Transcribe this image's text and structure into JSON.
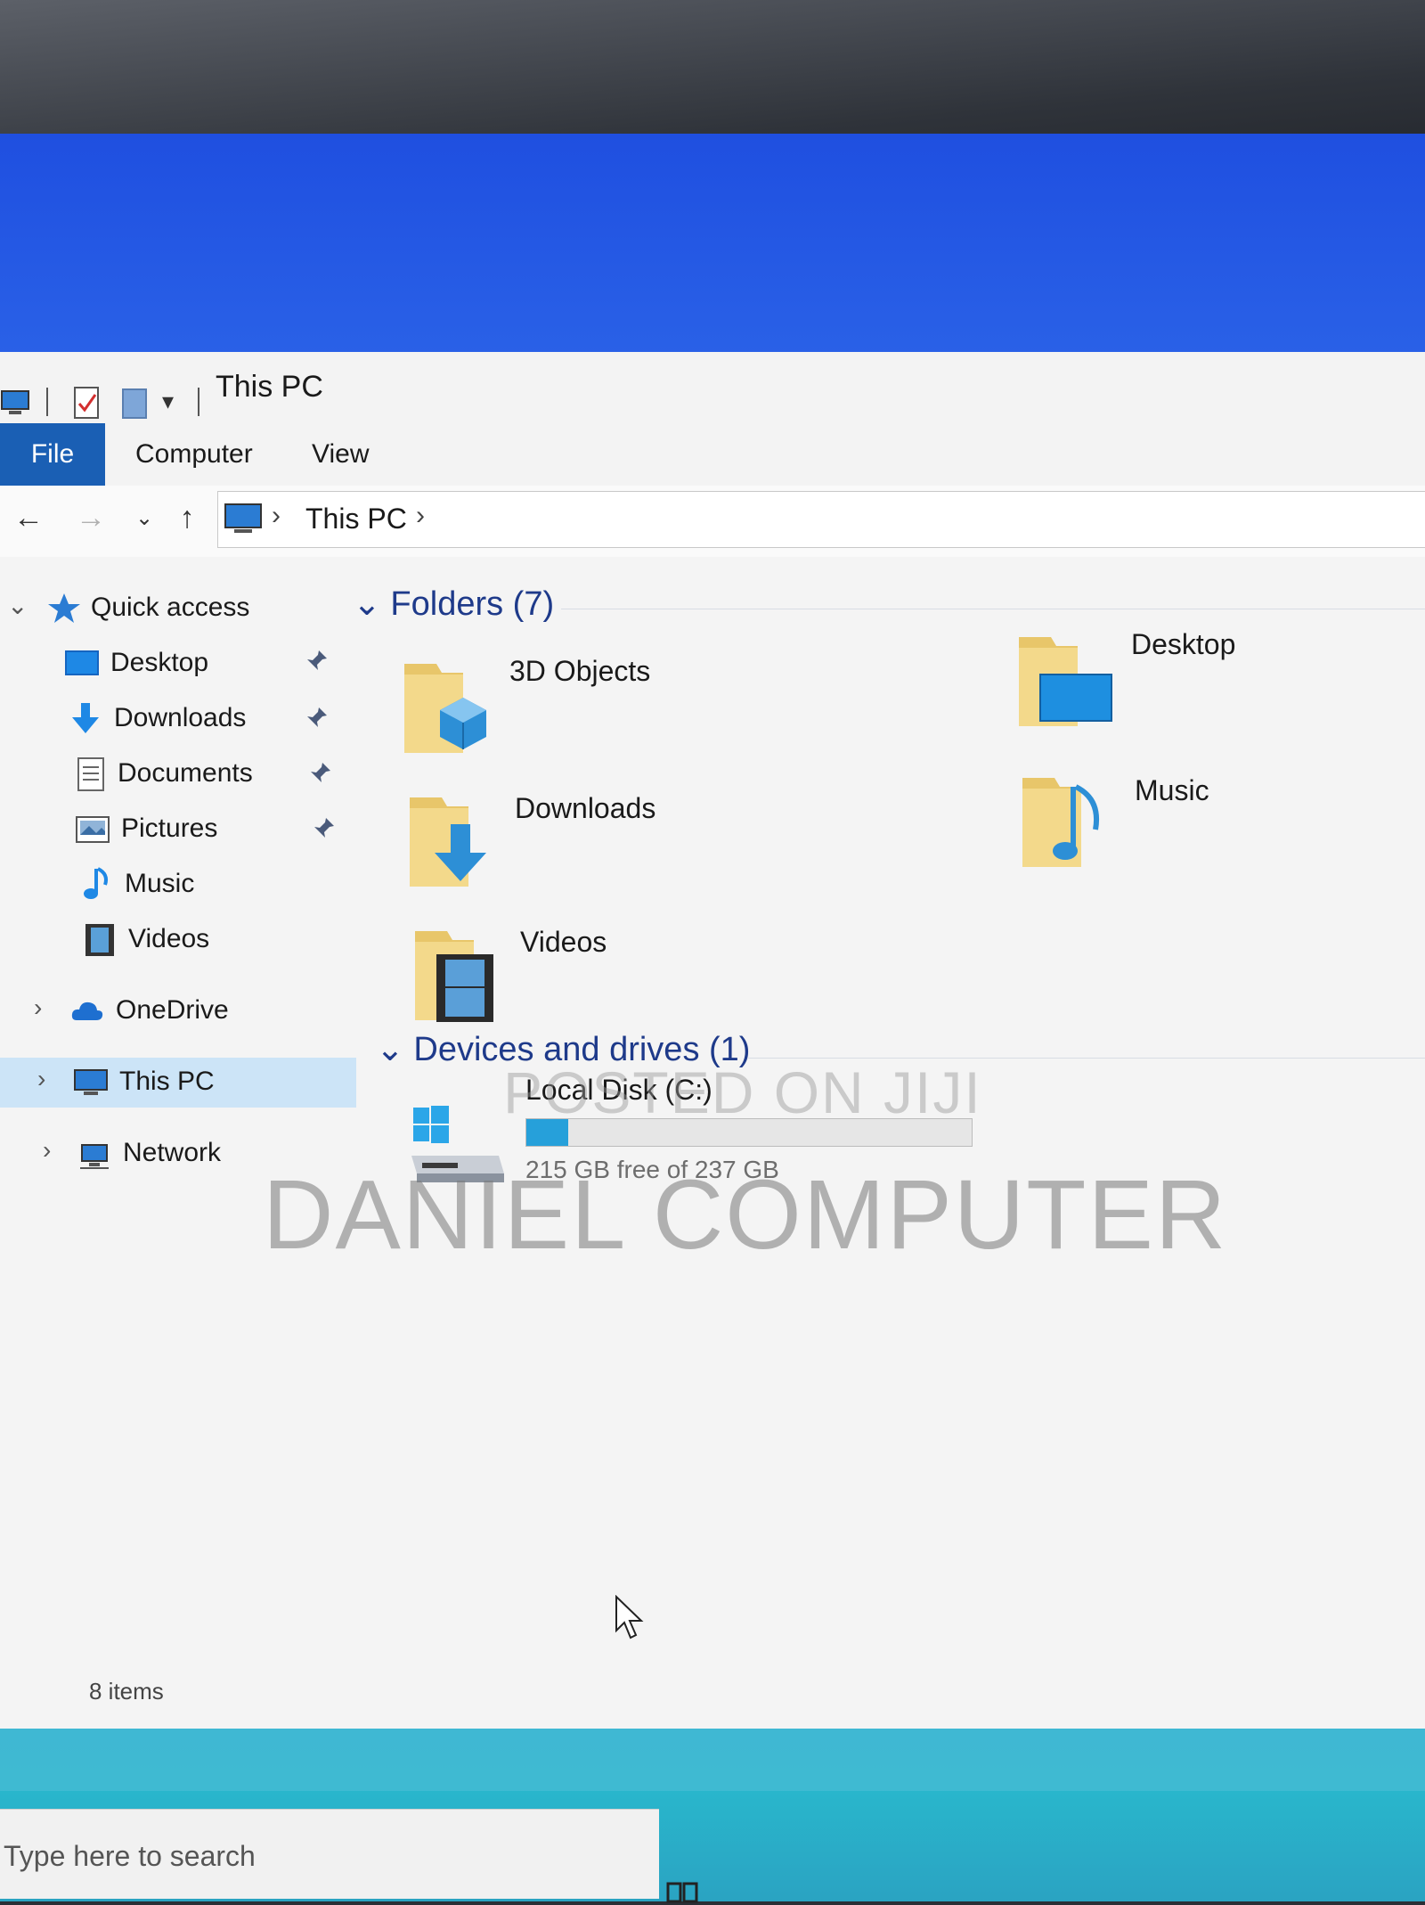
{
  "window": {
    "title": "This PC"
  },
  "ribbon": {
    "tabs": [
      {
        "label": "File"
      },
      {
        "label": "Computer"
      },
      {
        "label": "View"
      }
    ]
  },
  "address": {
    "path": "This PC"
  },
  "sidebar": {
    "quick_access": "Quick access",
    "items": [
      {
        "label": "Desktop",
        "icon": "desktop-icon",
        "pinned": true
      },
      {
        "label": "Downloads",
        "icon": "downloads-icon",
        "pinned": true
      },
      {
        "label": "Documents",
        "icon": "documents-icon",
        "pinned": true
      },
      {
        "label": "Pictures",
        "icon": "pictures-icon",
        "pinned": true
      },
      {
        "label": "Music",
        "icon": "music-icon",
        "pinned": false
      },
      {
        "label": "Videos",
        "icon": "videos-icon",
        "pinned": false
      }
    ],
    "onedrive": "OneDrive",
    "this_pc": "This PC",
    "network": "Network"
  },
  "content": {
    "folders_header": "Folders (7)",
    "folders": [
      {
        "label": "3D Objects",
        "icon": "3d-objects-icon"
      },
      {
        "label": "Desktop",
        "icon": "desktop-folder-icon"
      },
      {
        "label": "Downloads",
        "icon": "downloads-folder-icon"
      },
      {
        "label": "Music",
        "icon": "music-folder-icon"
      },
      {
        "label": "Videos",
        "icon": "videos-folder-icon"
      }
    ],
    "devices_header": "Devices and drives (1)",
    "drive": {
      "label": "Local Disk (C:)",
      "free_text": "215 GB free of 237 GB",
      "used_fraction": 0.093
    }
  },
  "status": {
    "items": "8 items"
  },
  "watermark": {
    "line1": "POSTED ON JIJI",
    "line2": "DANIEL COMPUTER"
  },
  "taskbar": {
    "search_placeholder": "Type here to search"
  },
  "colors": {
    "accent": "#1a5fb4",
    "header": "#1e3a8a",
    "selected": "#cce4f7",
    "drive_bar": "#26a0da"
  }
}
